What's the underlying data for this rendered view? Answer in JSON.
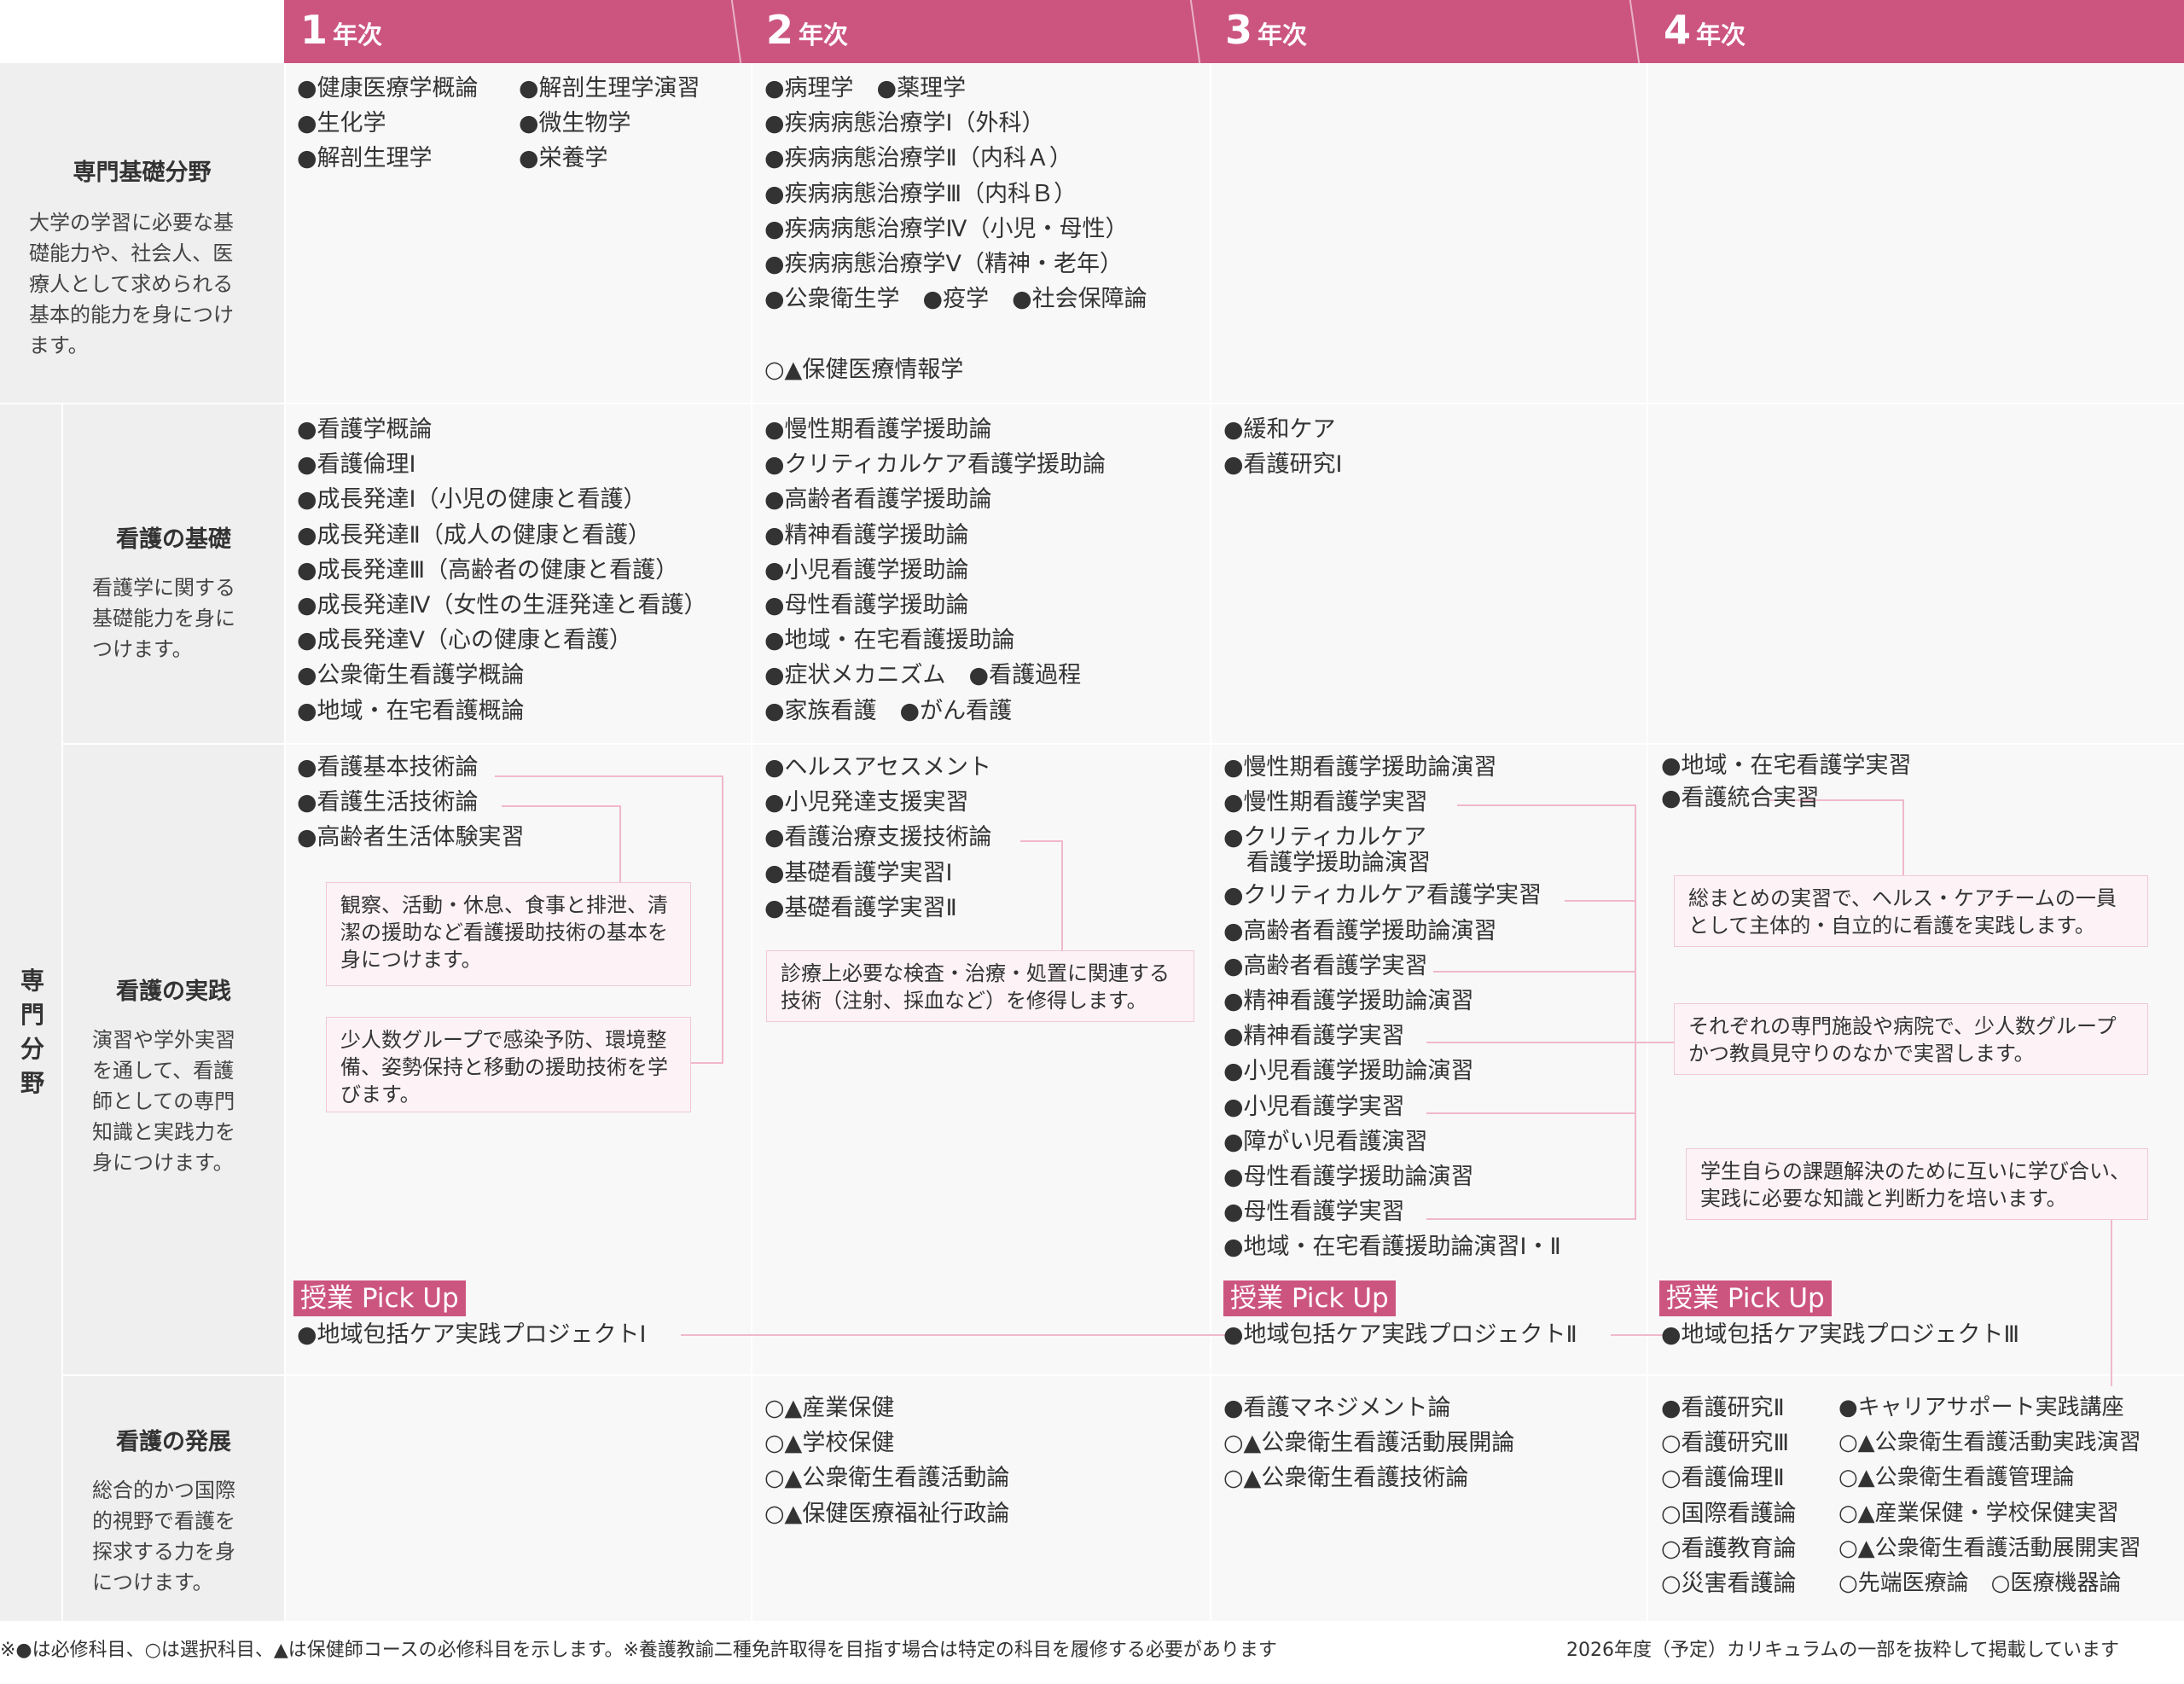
{
  "years": [
    "1",
    "2",
    "3",
    "4"
  ],
  "year_suffix": "年次",
  "categories": {
    "foundation": {
      "title": "専門基礎分野",
      "desc": [
        "大学の学習に必要な基",
        "礎能力や、社会人、医",
        "療人として求められる",
        "基本的能力を身につけ",
        "ます。"
      ]
    },
    "specialized_label": [
      "専",
      "門",
      "分",
      "野"
    ],
    "basics": {
      "title": "看護の基礎",
      "desc": [
        "看護学に関する",
        "基礎能力を身に",
        "つけます。"
      ]
    },
    "practice": {
      "title": "看護の実践",
      "desc": [
        "演習や学外実習",
        "を通して、看護",
        "師としての専門",
        "知識と実践力を",
        "身につけます。"
      ]
    },
    "development": {
      "title": "看護の発展",
      "desc": [
        "総合的かつ国際",
        "的視野で看護を",
        "探求する力を身",
        "につけます。"
      ]
    }
  },
  "foundation": {
    "y1": {
      "col_a": [
        "●健康医療学概論",
        "●生化学",
        "●解剖生理学"
      ],
      "col_b": [
        "●解剖生理学演習",
        "●微生物学",
        "●栄養学"
      ]
    },
    "y2": [
      "●病理学　●薬理学",
      "●疾病病態治療学Ⅰ（外科）",
      "●疾病病態治療学Ⅱ（内科Ａ）",
      "●疾病病態治療学Ⅲ（内科Ｂ）",
      "●疾病病態治療学Ⅳ（小児・母性）",
      "●疾病病態治療学Ⅴ（精神・老年）",
      "●公衆衛生学　●疫学　●社会保障論",
      "",
      "○▲保健医療情報学"
    ]
  },
  "basics": {
    "y1": [
      "●看護学概論",
      "●看護倫理Ⅰ",
      "●成長発達Ⅰ（小児の健康と看護）",
      "●成長発達Ⅱ（成人の健康と看護）",
      "●成長発達Ⅲ（高齢者の健康と看護）",
      "●成長発達Ⅳ（女性の生涯発達と看護）",
      "●成長発達Ⅴ（心の健康と看護）",
      "●公衆衛生看護学概論",
      "●地域・在宅看護概論"
    ],
    "y2": [
      "●慢性期看護学援助論",
      "●クリティカルケア看護学援助論",
      "●高齢者看護学援助論",
      "●精神看護学援助論",
      "●小児看護学援助論",
      "●母性看護学援助論",
      "●地域・在宅看護援助論",
      "●症状メカニズム　●看護過程",
      "●家族看護　●がん看護"
    ],
    "y3": [
      "●緩和ケア",
      "●看護研究Ⅰ"
    ]
  },
  "practice": {
    "y1": [
      "●看護基本技術論",
      "●看護生活技術論",
      "●高齢者生活体験実習"
    ],
    "y1_notes": [
      "観察、活動・休息、食事と排泄、清潔の援助など看護援助技術の基本を身につけます。",
      "少人数グループで感染予防、環境整備、姿勢保持と移動の援助技術を学びます。"
    ],
    "y2": [
      "●ヘルスアセスメント",
      "●小児発達支援実習",
      "●看護治療支援技術論",
      "●基礎看護学実習Ⅰ",
      "●基礎看護学実習Ⅱ"
    ],
    "y2_note": "診療上必要な検査・治療・処置に関連する技術（注射、採血など）を修得します。",
    "y3": [
      "●慢性期看護学援助論演習",
      "●慢性期看護学実習",
      "●クリティカルケア",
      "　看護学援助論演習",
      "●クリティカルケア看護学実習",
      "●高齢者看護学援助論演習",
      "●高齢者看護学実習",
      "●精神看護学援助論演習",
      "●精神看護学実習",
      "●小児看護学援助論演習",
      "●小児看護学実習",
      "●障がい児看護演習",
      "●母性看護学援助論演習",
      "●母性看護学実習",
      "●地域・在宅看護援助論演習Ⅰ・Ⅱ"
    ],
    "y4": [
      "●地域・在宅看護学実習",
      "●看護統合実習"
    ],
    "y4_notes": [
      "総まとめの実習で、ヘルス・ケアチームの一員として主体的・自立的に看護を実践します。",
      "それぞれの専門施設や病院で、少人数グループかつ教員見守りのなかで実習します。",
      "学生自らの課題解決のために互いに学び合い、実践に必要な知識と判断力を培います。"
    ],
    "pickup_label": "授業 Pick Up",
    "pickups": [
      "●地域包括ケア実践プロジェクトⅠ",
      "●地域包括ケア実践プロジェクトⅡ",
      "●地域包括ケア実践プロジェクトⅢ"
    ]
  },
  "development": {
    "y2": [
      "○▲産業保健",
      "○▲学校保健",
      "○▲公衆衛生看護活動論",
      "○▲保健医療福祉行政論"
    ],
    "y3": [
      "●看護マネジメント論",
      "○▲公衆衛生看護活動展開論",
      "○▲公衆衛生看護技術論"
    ],
    "y4_a": [
      "●看護研究Ⅱ",
      "○看護研究Ⅲ",
      "○看護倫理Ⅱ",
      "○国際看護論",
      "○看護教育論",
      "○災害看護論"
    ],
    "y4_b": [
      "●キャリアサポート実践講座",
      "○▲公衆衛生看護活動実践演習",
      "○▲公衆衛生看護管理論",
      "○▲産業保健・学校保健実習",
      "○▲公衆衛生看護活動展開実習",
      "○先端医療論　○医療機器論"
    ]
  },
  "footer": {
    "left": "※●は必修科目、○は選択科目、▲は保健師コースの必修科目を示します。※養護教諭二種免許取得を目指す場合は特定の科目を履修する必要があります",
    "right": "2026年度（予定）カリキュラムの一部を抜粋して掲載しています"
  },
  "colors": {
    "accent": "#cc5580",
    "note_bg": "#fdf3f6",
    "note_border": "#f0c8d5"
  }
}
